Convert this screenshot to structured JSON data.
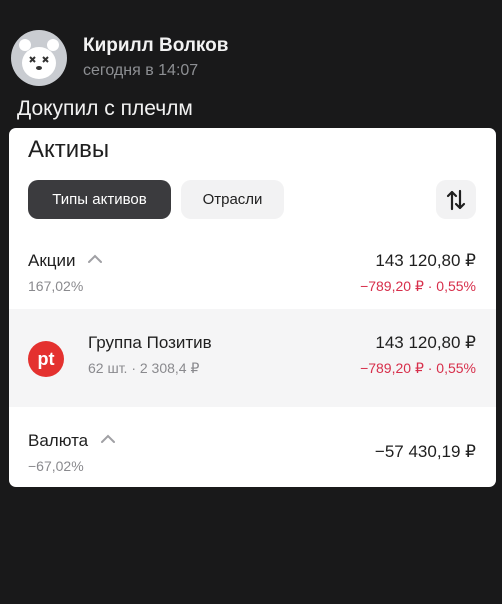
{
  "post": {
    "author": "Кирилл Волков",
    "time": "сегодня в 14:07",
    "text": "Докупил с плечлм"
  },
  "card": {
    "title": "Активы",
    "tabs": [
      {
        "label": "Типы активов",
        "active": true
      },
      {
        "label": "Отрасли",
        "active": false
      }
    ],
    "sort_icon": "sort-arrows-icon",
    "groups": [
      {
        "name": "Акции",
        "share": "167,02%",
        "amount": "143 120,80 ₽",
        "change": "−789,20 ₽ · 0,55%"
      },
      {
        "name": "Валюта",
        "share": "−67,02%",
        "amount": "−57 430,19 ₽"
      }
    ],
    "stock": {
      "logo_text": "pt",
      "name": "Группа Позитив",
      "details": "62 шт. · 2 308,4 ₽",
      "amount": "143 120,80 ₽",
      "change": "−789,20 ₽ · 0,55%"
    }
  },
  "colors": {
    "background": "#19191a",
    "negative": "#d72f4b",
    "logo": "#e4312f",
    "active_tab": "#3b3b3e"
  }
}
